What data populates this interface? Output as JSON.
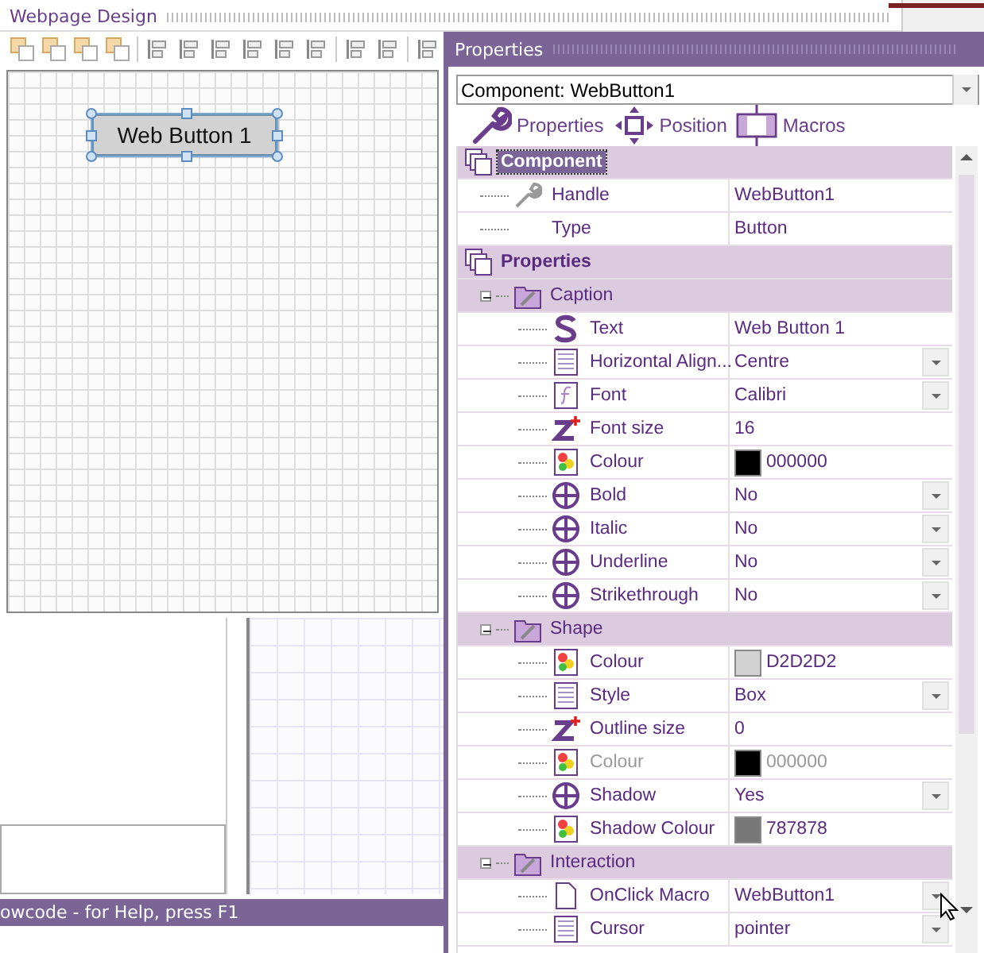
{
  "design_window": {
    "title": "Webpage Design",
    "canvas_button": {
      "label": "Web Button 1",
      "selected": true
    }
  },
  "status_bar": {
    "text": "owcode - for Help, press F1"
  },
  "properties_panel": {
    "title": "Properties",
    "component_select": {
      "value": "Component: WebButton1"
    },
    "tabs": [
      {
        "label": "Properties",
        "kind": "wrench"
      },
      {
        "label": "Position",
        "kind": "move"
      },
      {
        "label": "Macros",
        "kind": "macro"
      }
    ],
    "tree": [
      {
        "kind": "category",
        "label": "Component",
        "selected": true,
        "children": [
          {
            "kind": "wrench",
            "label": "Handle",
            "value": "WebButton1",
            "dropdown": false,
            "disabled": false
          },
          {
            "kind": "plain",
            "label": "Type",
            "value": "Button",
            "dropdown": false,
            "disabled": false
          }
        ]
      },
      {
        "kind": "category",
        "label": "Properties",
        "selected": false,
        "children": [
          {
            "kind": "group",
            "label": "Caption",
            "expanded": true,
            "children": [
              {
                "kind": "text",
                "label": "Text",
                "value": "Web Button 1",
                "dropdown": false,
                "disabled": false
              },
              {
                "kind": "list",
                "label": "Horizontal Align...",
                "value": "Centre",
                "dropdown": true,
                "disabled": false
              },
              {
                "kind": "font",
                "label": "Font",
                "value": "Calibri",
                "dropdown": true,
                "disabled": false
              },
              {
                "kind": "number",
                "label": "Font size",
                "value": "16",
                "dropdown": false,
                "disabled": false
              },
              {
                "kind": "colour",
                "label": "Colour",
                "value": "000000",
                "color": "#000000",
                "dropdown": false,
                "disabled": false
              },
              {
                "kind": "option",
                "label": "Bold",
                "value": "No",
                "dropdown": true,
                "disabled": false
              },
              {
                "kind": "option",
                "label": "Italic",
                "value": "No",
                "dropdown": true,
                "disabled": false
              },
              {
                "kind": "option",
                "label": "Underline",
                "value": "No",
                "dropdown": true,
                "disabled": false
              },
              {
                "kind": "option",
                "label": "Strikethrough",
                "value": "No",
                "dropdown": true,
                "disabled": false
              }
            ]
          },
          {
            "kind": "group",
            "label": "Shape",
            "expanded": true,
            "children": [
              {
                "kind": "colour",
                "label": "Colour",
                "value": "D2D2D2",
                "color": "#d2d2d2",
                "dropdown": false,
                "disabled": false
              },
              {
                "kind": "list",
                "label": "Style",
                "value": "Box",
                "dropdown": true,
                "disabled": false
              },
              {
                "kind": "number",
                "label": "Outline size",
                "value": "0",
                "dropdown": false,
                "disabled": false
              },
              {
                "kind": "colour",
                "label": "Colour",
                "value": "000000",
                "color": "#000000",
                "dropdown": false,
                "disabled": true
              },
              {
                "kind": "option",
                "label": "Shadow",
                "value": "Yes",
                "dropdown": true,
                "disabled": false
              },
              {
                "kind": "colour",
                "label": "Shadow Colour",
                "value": "787878",
                "color": "#787878",
                "dropdown": false,
                "disabled": false
              }
            ]
          },
          {
            "kind": "group",
            "label": "Interaction",
            "expanded": true,
            "children": [
              {
                "kind": "macro",
                "label": "OnClick Macro",
                "value": "WebButton1",
                "dropdown": true,
                "disabled": false
              },
              {
                "kind": "list",
                "label": "Cursor",
                "value": "pointer",
                "dropdown": true,
                "disabled": false
              }
            ]
          }
        ]
      }
    ]
  }
}
